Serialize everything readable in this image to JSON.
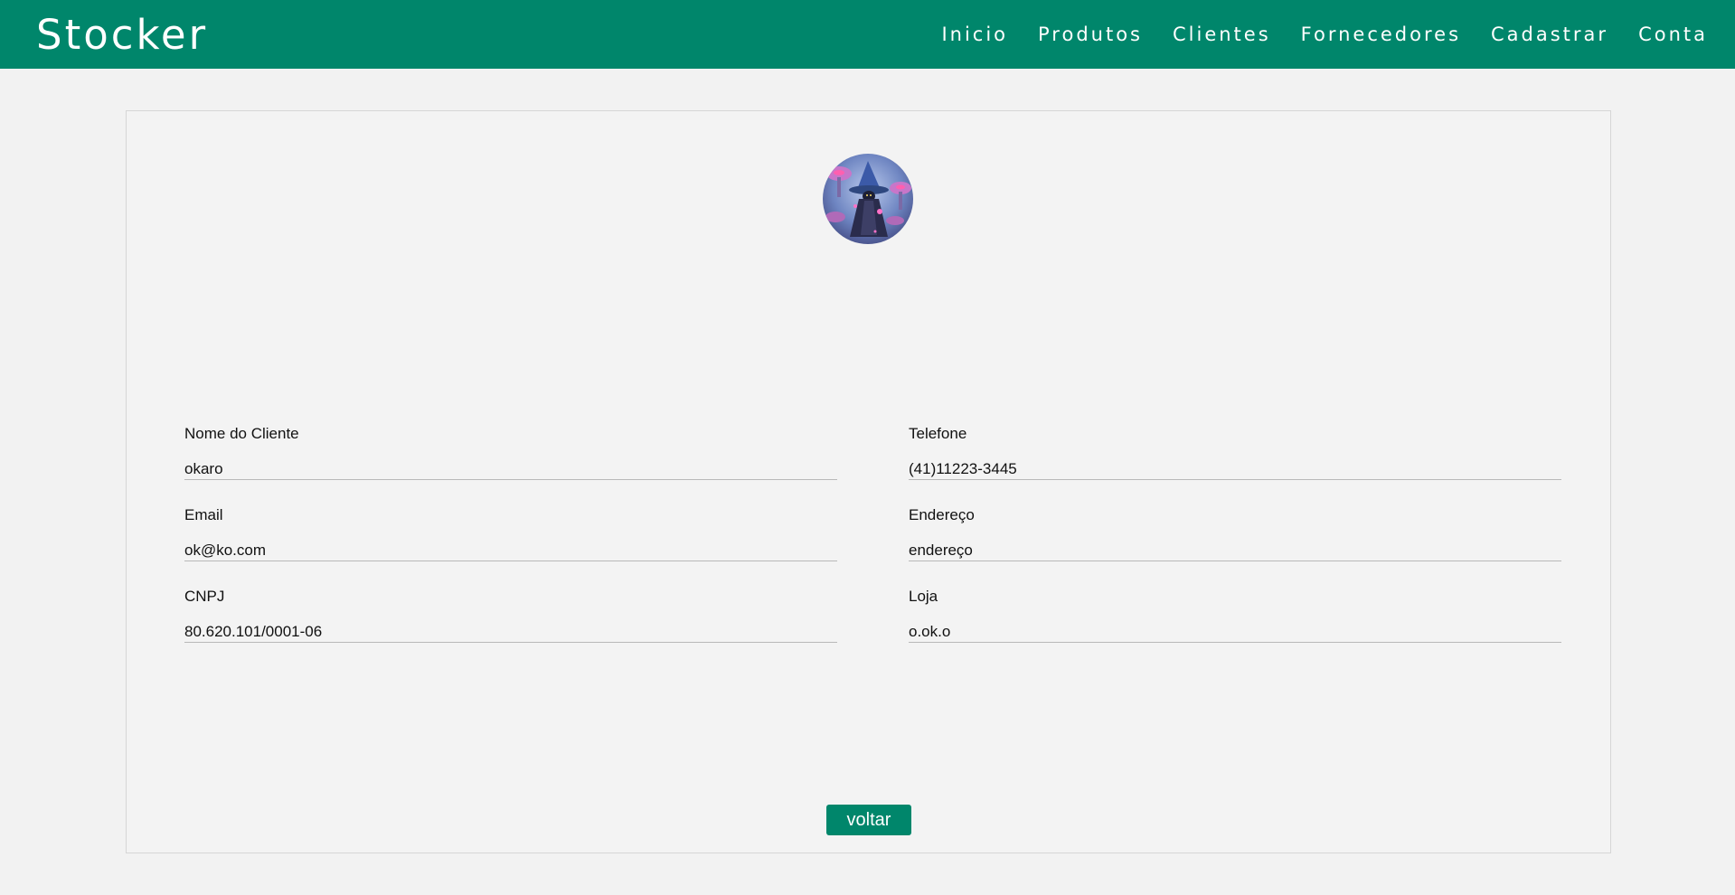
{
  "navbar": {
    "brand": "Stocker",
    "links": [
      "Inicio",
      "Produtos",
      "Clientes",
      "Fornecedores",
      "Cadastrar",
      "Conta"
    ],
    "color": "#00866b"
  },
  "profile": {
    "avatar_icon": "client-avatar-image"
  },
  "form": {
    "nome": {
      "label": "Nome do Cliente",
      "value": "okaro"
    },
    "telefone": {
      "label": "Telefone",
      "value": "(41)11223-3445"
    },
    "email": {
      "label": "Email",
      "value": "ok@ko.com"
    },
    "endereco": {
      "label": "Endereço",
      "value": "endereço"
    },
    "cnpj": {
      "label": "CNPJ",
      "value": "80.620.101/0001-06"
    },
    "loja": {
      "label": "Loja",
      "value": "o.ok.o"
    }
  },
  "actions": {
    "back_label": "voltar"
  }
}
